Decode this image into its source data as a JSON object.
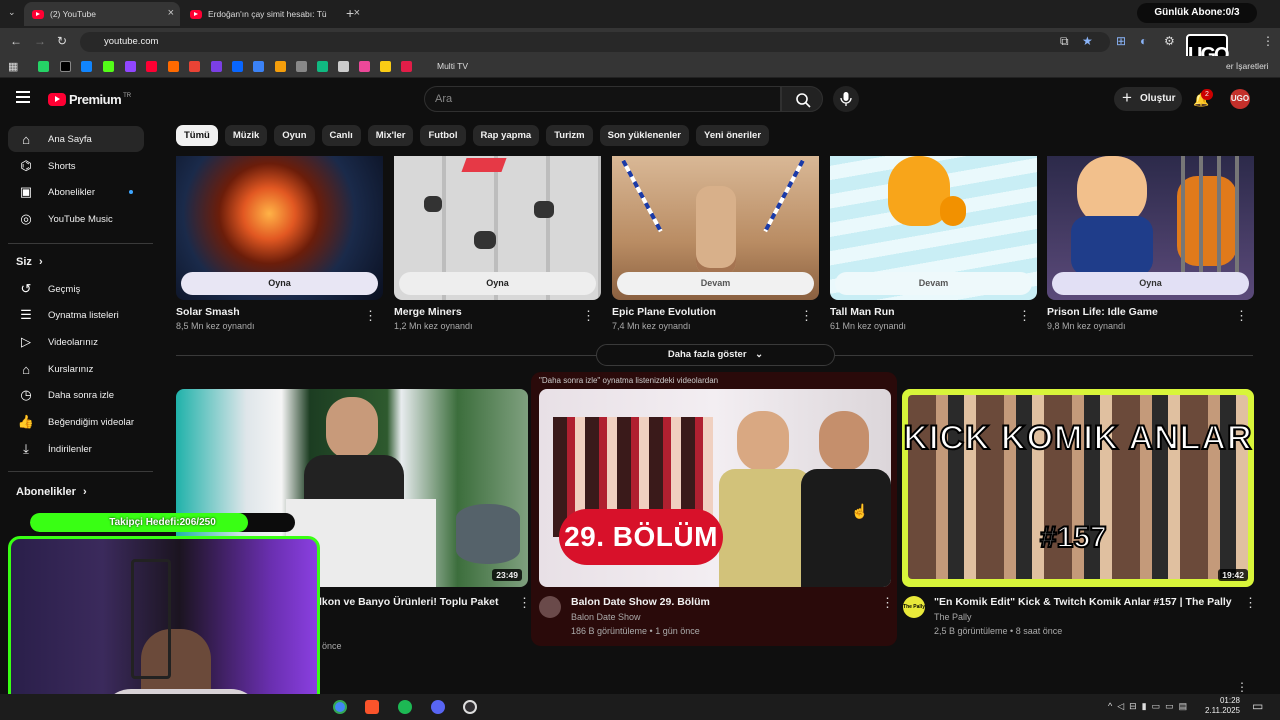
{
  "browser": {
    "tabs": [
      {
        "title": "(2) YouTube"
      },
      {
        "title": "Erdoğan'ın çay simit hesabı: Tü"
      }
    ],
    "url": "youtube.com",
    "bookmark_label": "Multi TV",
    "bookmarks_right": "er İşaretleri",
    "logo_text": "UGO"
  },
  "overlay": {
    "sub_counter": "Günlük Abone:0/3",
    "follower_goal": "Takipçi Hedefi:206/250",
    "follower_progress": 0.824
  },
  "header": {
    "logo_word": "Premium",
    "region": "TR",
    "search_placeholder": "Ara",
    "create_label": "Oluştur",
    "notif_count": "2",
    "avatar_text": "UGO"
  },
  "chips": [
    "Tümü",
    "Müzik",
    "Oyun",
    "Canlı",
    "Mix'ler",
    "Futbol",
    "Rap yapma",
    "Turizm",
    "Son yüklenenler",
    "Yeni öneriler"
  ],
  "sidebar": {
    "main": [
      {
        "label": "Ana Sayfa",
        "icon": "home-icon"
      },
      {
        "label": "Shorts",
        "icon": "shorts-icon"
      },
      {
        "label": "Abonelikler",
        "icon": "subscriptions-icon"
      },
      {
        "label": "YouTube Music",
        "icon": "music-icon"
      }
    ],
    "you_heading": "Siz",
    "you": [
      {
        "label": "Geçmiş",
        "icon": "history-icon"
      },
      {
        "label": "Oynatma listeleri",
        "icon": "playlist-icon"
      },
      {
        "label": "Videolarınız",
        "icon": "video-icon"
      },
      {
        "label": "Kurslarınız",
        "icon": "course-icon"
      },
      {
        "label": "Daha sonra izle",
        "icon": "clock-icon"
      },
      {
        "label": "Beğendiğim videolar",
        "icon": "like-icon"
      },
      {
        "label": "İndirilenler",
        "icon": "download-icon"
      }
    ],
    "subs_heading": "Abonelikler"
  },
  "games": [
    {
      "title": "Solar Smash",
      "meta": "8,5 Mn kez oynandı",
      "button": "Oyna"
    },
    {
      "title": "Merge Miners",
      "meta": "1,2 Mn kez oynandı",
      "button": "Oyna"
    },
    {
      "title": "Epic Plane Evolution",
      "meta": "7,4 Mn kez oynandı",
      "button": "Devam"
    },
    {
      "title": "Tall Man Run",
      "meta": "61 Mn kez oynandı",
      "button": "Devam"
    },
    {
      "title": "Prison Life: Idle Game",
      "meta": "9,8 Mn kez oynandı",
      "button": "Oyna"
    }
  ],
  "more_games": "Daha fazla göster",
  "videos": [
    {
      "title": "lkon ve Banyo Ürünleri! Toplu Paket",
      "channel": "",
      "stats": "önce",
      "duration": "23:49"
    },
    {
      "title": "Balon Date Show 29. Bölüm",
      "channel": "Balon Date Show",
      "stats": "186 B görüntüleme • 1 gün önce",
      "duration": "",
      "note": "\"Daha sonra izle\" oynatma listenizdeki videolardan",
      "thumb_text": "29. BÖLÜM"
    },
    {
      "title": "\"En Komik Edit\" Kick & Twitch Komik Anlar #157 | The Pally",
      "channel": "The Pally",
      "stats": "2,5 B görüntüleme • 8 saat önce",
      "duration": "19:42",
      "thumb_text": "KICK KOMIK ANLAR",
      "thumb_num": "#157",
      "avatar_text": "The Pally"
    }
  ],
  "taskbar": {
    "time": "01:28",
    "date": "2.11.2025"
  }
}
